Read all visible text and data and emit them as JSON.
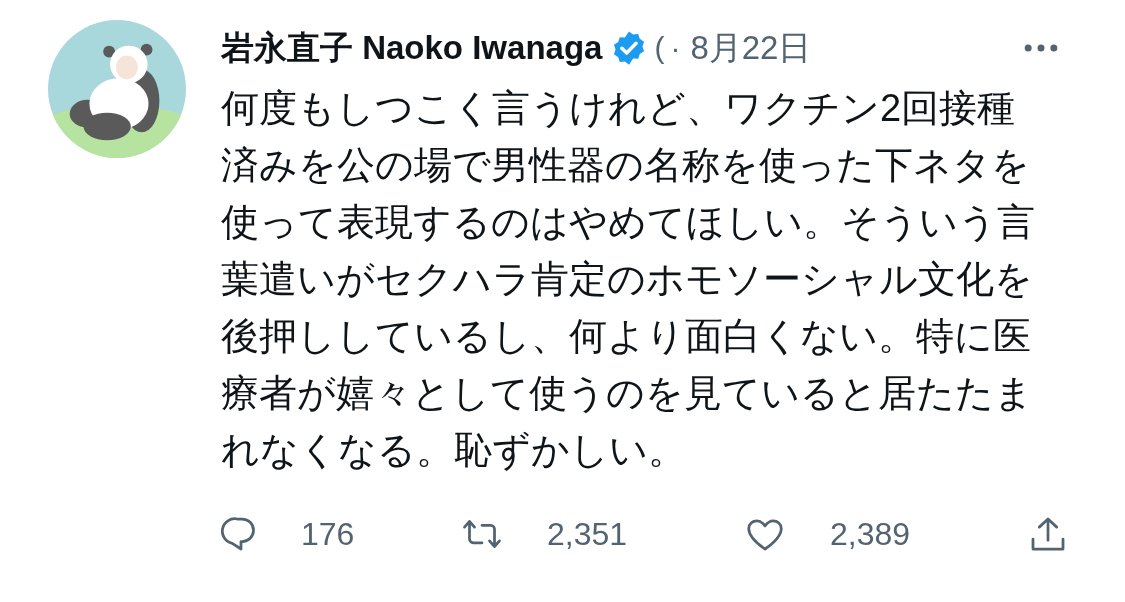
{
  "tweet": {
    "author": {
      "name": "岩永直子 Naoko Iwanaga",
      "verified": true,
      "handle": "(",
      "separator": "·",
      "date": "8月22日"
    },
    "text": "何度もしつこく言うけれど、ワクチン2回接種済みを公の場で男性器の名称を使った下ネタを使って表現するのはやめてほしい。そういう言葉遣いがセクハラ肯定のホモソーシャル文化を後押ししているし、何より面白くない。特に医療者が嬉々として使うのを見ていると居たたまれなくなる。恥ずかしい。",
    "actions": [
      {
        "kind": "reply",
        "count": "176"
      },
      {
        "kind": "retweet",
        "count": "2,351"
      },
      {
        "kind": "like",
        "count": "2,389"
      },
      {
        "kind": "share"
      }
    ]
  }
}
